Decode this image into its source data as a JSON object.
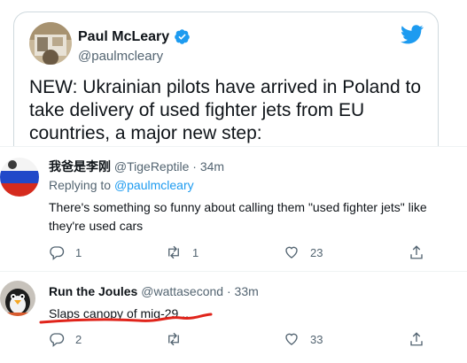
{
  "quoted_tweet": {
    "author_name": "Paul McLeary",
    "handle": "@paulmcleary",
    "text": "NEW: Ukrainian pilots have arrived in Poland to take delivery of used fighter jets from EU countries, a major new step:"
  },
  "replies": [
    {
      "author_name": "我爸是李刚",
      "handle": "@TigeReptile",
      "separator": "·",
      "time": "34m",
      "replying_prefix": "Replying to ",
      "replying_to": "@paulmcleary",
      "text": "There's something so funny about calling them \"used fighter jets\" like they're used cars",
      "reply_count": "1",
      "retweet_count": "1",
      "like_count": "23"
    },
    {
      "author_name": "Run the Joules",
      "handle": "@wattasecond",
      "separator": "·",
      "time": "33m",
      "text": "Slaps canopy of mig-29...",
      "reply_count": "2",
      "retweet_count": "",
      "like_count": "33"
    }
  ],
  "colors": {
    "accent": "#1d9bf0",
    "text": "#0f1419",
    "muted": "#536471",
    "border": "#cfd9de",
    "annotation": "#e0241b"
  },
  "icons": [
    "verified-icon",
    "twitter-bird-icon",
    "reply-icon",
    "retweet-icon",
    "like-icon",
    "share-icon"
  ]
}
